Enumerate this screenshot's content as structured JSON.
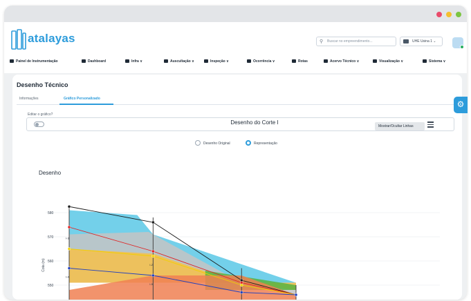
{
  "window": {
    "controls": [
      "close",
      "minimize",
      "maximize"
    ],
    "colors": {
      "close": "#e94b6b",
      "minimize": "#f5bf2f",
      "maximize": "#7cc542"
    }
  },
  "header": {
    "logo_text": "atalayas",
    "search_placeholder": "Buscar no empreendimento...",
    "unit_selector": "UHE Usina 1",
    "accent": "#2d9cdb"
  },
  "nav": {
    "items": [
      {
        "label": "Painel de Instrumentação",
        "icon": "database-icon",
        "dropdown": false
      },
      {
        "label": "Dashboard",
        "icon": "home-icon",
        "dropdown": false
      },
      {
        "label": "Infra",
        "icon": "grid-icon",
        "dropdown": true
      },
      {
        "label": "Auscultação",
        "icon": "dam-icon",
        "dropdown": true
      },
      {
        "label": "Inspeção",
        "icon": "clipboard-icon",
        "dropdown": true
      },
      {
        "label": "Ocorrência",
        "icon": "gears-icon",
        "dropdown": true
      },
      {
        "label": "Rotas",
        "icon": "route-icon",
        "dropdown": false
      },
      {
        "label": "Acervo Técnico",
        "icon": "book-icon",
        "dropdown": true
      },
      {
        "label": "Visualização",
        "icon": "eye-icon",
        "dropdown": true
      },
      {
        "label": "Sistema",
        "icon": "gear-icon",
        "dropdown": true
      }
    ]
  },
  "page": {
    "title": "Desenho Técnico",
    "tabs": [
      {
        "label": "Informações",
        "active": false
      },
      {
        "label": "Gráfico Personalizado",
        "active": true
      }
    ],
    "edit_label": "Editar o gráfico?",
    "edit_toggle_on": false,
    "radio_options": [
      {
        "label": "Desenho Original",
        "selected": false
      },
      {
        "label": "Representação",
        "selected": true
      }
    ],
    "section_title": "Desenho",
    "toggle_lines_button": "Mostrar/Ocultar Linhas"
  },
  "chart_data": {
    "type": "area",
    "title": "Desenho do Corte I",
    "xlabel": "",
    "ylabel": "Cota (m)",
    "yticks": [
      580,
      570,
      560,
      550
    ],
    "ylim": [
      544,
      584
    ],
    "xlim": [
      0,
      100
    ],
    "grid": true,
    "layers": [
      {
        "color": "#5bc8e6",
        "polygon": [
          [
            0,
            581
          ],
          [
            30,
            579
          ],
          [
            37,
            571
          ],
          [
            100,
            551
          ],
          [
            0,
            551
          ]
        ]
      },
      {
        "color": "#c4c4c4",
        "polygon": [
          [
            0,
            571
          ],
          [
            35,
            572
          ],
          [
            76,
            551
          ],
          [
            100,
            546
          ],
          [
            100,
            551
          ],
          [
            0,
            551
          ]
        ]
      },
      {
        "color": "#f6c04a",
        "polygon": [
          [
            0,
            565
          ],
          [
            37,
            563
          ],
          [
            75,
            551
          ],
          [
            100,
            548
          ],
          [
            100,
            551
          ],
          [
            0,
            551
          ]
        ]
      },
      {
        "color": "#57b341",
        "polygon": [
          [
            60,
            556
          ],
          [
            80,
            553
          ],
          [
            100,
            550
          ],
          [
            100,
            548
          ],
          [
            60,
            548
          ]
        ]
      },
      {
        "color": "#f08052",
        "polygon": [
          [
            0,
            548
          ],
          [
            37,
            554
          ],
          [
            76,
            554
          ],
          [
            100,
            546
          ],
          [
            100,
            544
          ],
          [
            0,
            544
          ]
        ]
      }
    ],
    "series": [
      {
        "color": "#1a1a1a",
        "x": [
          0,
          37,
          76,
          100
        ],
        "y": [
          582.5,
          576,
          552,
          546
        ]
      },
      {
        "color": "#e02020",
        "x": [
          0,
          37,
          76,
          100
        ],
        "y": [
          574,
          564,
          551,
          546
        ]
      },
      {
        "color": "#f0d000",
        "x": [
          0,
          37,
          76,
          100
        ],
        "y": [
          565,
          562,
          550,
          546
        ]
      },
      {
        "color": "#1f3fbf",
        "x": [
          0,
          37,
          76,
          100
        ],
        "y": [
          557,
          554,
          547,
          546
        ]
      }
    ],
    "instruments": [
      {
        "x": 0,
        "top": 583,
        "bottom": 544
      },
      {
        "x": 37,
        "top": 578,
        "bottom": 544
      },
      {
        "x": 76,
        "top": 557,
        "bottom": 544
      },
      {
        "x": 100,
        "top": 550,
        "bottom": 544
      }
    ],
    "labels": [
      {
        "text": "I-3",
        "x": 0,
        "y": 569
      },
      {
        "text": "I-2",
        "x": 37,
        "y": 558
      },
      {
        "text": "I-4",
        "x": 0,
        "y": 553
      },
      {
        "text": "I-5",
        "x": 37,
        "y": 550
      }
    ]
  }
}
